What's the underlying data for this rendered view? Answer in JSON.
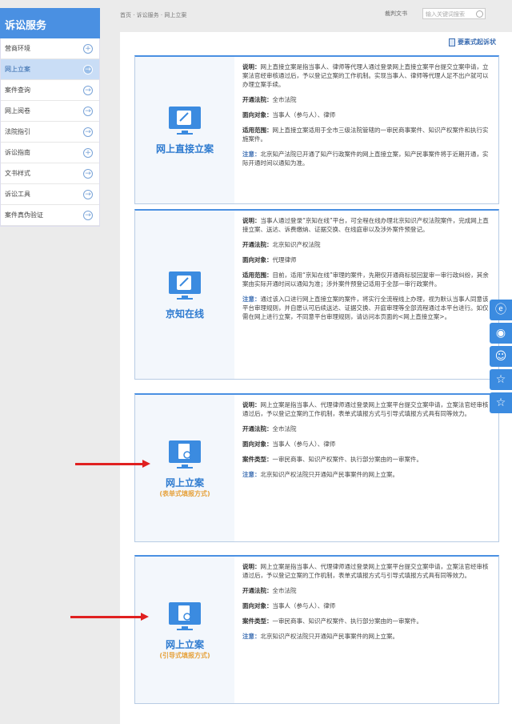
{
  "sidebar": {
    "title": "诉讼服务",
    "items": [
      {
        "label": "营商环境",
        "icon": "+"
      },
      {
        "label": "网上立案",
        "icon": "→"
      },
      {
        "label": "案件查询",
        "icon": "→"
      },
      {
        "label": "网上阅卷",
        "icon": "→"
      },
      {
        "label": "法院指引",
        "icon": "→"
      },
      {
        "label": "诉讼指南",
        "icon": "+"
      },
      {
        "label": "文书样式",
        "icon": "→"
      },
      {
        "label": "诉讼工具",
        "icon": "→"
      },
      {
        "label": "案件真伪验证",
        "icon": "→"
      }
    ]
  },
  "header": {
    "breadcrumb": "首页 · 诉讼服务 · 网上立案",
    "doc_link": "裁判文书",
    "search_placeholder": "输入关键词搜索"
  },
  "main": {
    "element_link": "要素式起诉状",
    "cards": [
      {
        "title": "网上直接立案",
        "subtitle": "",
        "desc_label": "说明：",
        "desc": "网上直接立案是指当事人、律师等代理人通过登录网上直接立案平台提交立案申请，立案法官经审核通过后，予以登记立案的工作机制。实现当事人、律师等代理人足不出户就可以办理立案手续。",
        "court_label": "开通法院：",
        "court": "全市法院",
        "target_label": "面向对象：",
        "target": "当事人（参与人）、律师",
        "scope_label": "适用范围：",
        "scope": "网上直接立案适用于全市三级法院管辖的一审民商事案件、知识产权案件和执行实施案件。",
        "note_label": "注意：",
        "note": "北京知产法院已开通了知产行政案件的网上直接立案，知产民事案件将于近期开通，实际开通时间以通知为准。"
      },
      {
        "title": "京知在线",
        "subtitle": "",
        "desc_label": "说明：",
        "desc": "当事人通过登录“京知在线”平台，可全程在线办理北京知识产权法院案件，完成网上直接立案、送达、诉费缴纳、证据交换、在线庭审以及涉外案件预登记。",
        "court_label": "开通法院：",
        "court": "北京知识产权法院",
        "target_label": "面向对象：",
        "target": "代理律师",
        "scope_label": "适用范围：",
        "scope": "目前，适用“京知在线”审理的案件，先期仅开通商标驳回复审一审行政纠纷，其余案由实际开通时间以通知为准；涉外案件预登记适用于全部一审行政案件。",
        "note_label": "注意：",
        "note": "通过该入口进行网上直接立案的案件，将实行全流程线上办理，视为默认当事人同意该平台审理规则，并自愿认可后续送达、证据交换、开庭审理等全部流程通过本平台进行。如仅需在网上进行立案，不同意平台审理规则，请访问本页面的<网上直接立案>。"
      },
      {
        "title": "网上立案",
        "subtitle": "(表单式填报方式)",
        "desc_label": "说明：",
        "desc": "网上立案是指当事人、代理律师通过登录网上立案平台提交立案申请，立案法官经审核通过后，予以登记立案的工作机制，表单式填报方式与引导式填报方式具有同等效力。",
        "court_label": "开通法院：",
        "court": "全市法院",
        "target_label": "面向对象：",
        "target": "当事人（参与人）、律师",
        "scope_label": "案件类型：",
        "scope": "一审民商事、知识产权案件、执行部分案由的一审案件。",
        "note_label": "注意：",
        "note": "北京知识产权法院只开通知产民事案件的网上立案。"
      },
      {
        "title": "网上立案",
        "subtitle": "(引导式填报方式)",
        "desc_label": "说明：",
        "desc": "网上立案是指当事人、代理律师通过登录网上立案平台提交立案申请，立案法官经审核通过后，予以登记立案的工作机制，表单式填报方式与引导式填报方式具有同等效力。",
        "court_label": "开通法院：",
        "court": "全市法院",
        "target_label": "面向对象：",
        "target": "当事人（参与人）、律师",
        "scope_label": "案件类型：",
        "scope": "一审民商事、知识产权案件、执行部分案由的一审案件。",
        "note_label": "注意：",
        "note": "北京知识产权法院只开通知产民事案件的网上立案。"
      }
    ]
  },
  "float_buttons": [
    "e-icon",
    "badge-icon",
    "people-icon",
    "star-icon",
    "star-icon"
  ],
  "colors": {
    "accent": "#4a90e2",
    "title_blue": "#2e7bd0",
    "subtitle_orange": "#e6a23c",
    "arrow_red": "#e02020"
  }
}
